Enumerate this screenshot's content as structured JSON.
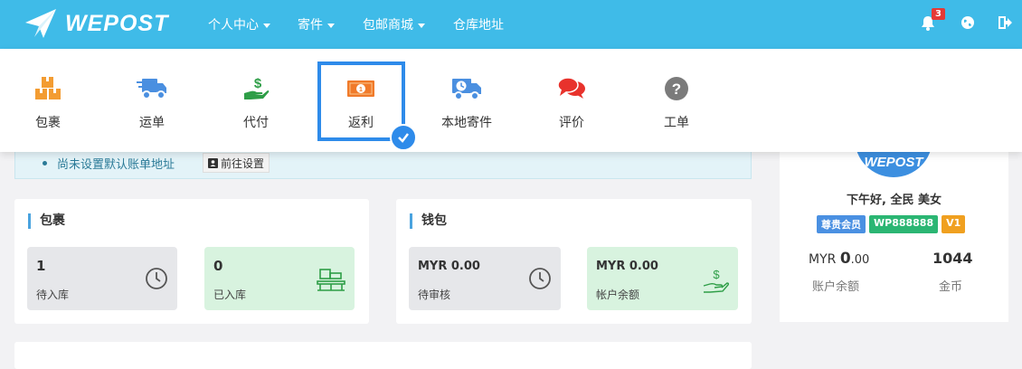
{
  "brand": {
    "logo_text": "WEPOST"
  },
  "nav": {
    "items": [
      "个人中心",
      "寄件",
      "包邮商城",
      "仓库地址"
    ]
  },
  "header": {
    "notification_count": "3"
  },
  "quick_menu": [
    {
      "label": "包裹",
      "icon": "packages-icon"
    },
    {
      "label": "运单",
      "icon": "delivery-truck-icon"
    },
    {
      "label": "代付",
      "icon": "hand-dollar-icon"
    },
    {
      "label": "返利",
      "icon": "money-bill-icon"
    },
    {
      "label": "本地寄件",
      "icon": "truck-clock-icon"
    },
    {
      "label": "评价",
      "icon": "comments-icon"
    },
    {
      "label": "工单",
      "icon": "question-circle-icon"
    }
  ],
  "notice": {
    "text": "尚未设置默认账单地址",
    "button": "前往设置"
  },
  "packages": {
    "title": "包裹",
    "pending": {
      "value": "1",
      "label": "待入库"
    },
    "stored": {
      "value": "0",
      "label": "已入库"
    }
  },
  "wallet": {
    "title": "钱包",
    "review": {
      "value": "MYR 0.00",
      "label": "待审核"
    },
    "balance": {
      "value": "MYR 0.00",
      "label": "帐户余额"
    }
  },
  "profile": {
    "avatar_text": "WEPOST",
    "greeting": "下午好, 全民 美女",
    "tags": [
      "尊贵会员",
      "WP888888",
      "V1"
    ],
    "tag_colors": [
      "#4a90e2",
      "#2bb673",
      "#f0a020"
    ],
    "currency": "MYR",
    "balance_int": "0",
    "balance_dec": ".00",
    "balance_label": "账户余额",
    "coins": "1044",
    "coins_label": "金币"
  },
  "colors": {
    "brand": "#3fbbe8",
    "selection": "#2e8bea"
  }
}
